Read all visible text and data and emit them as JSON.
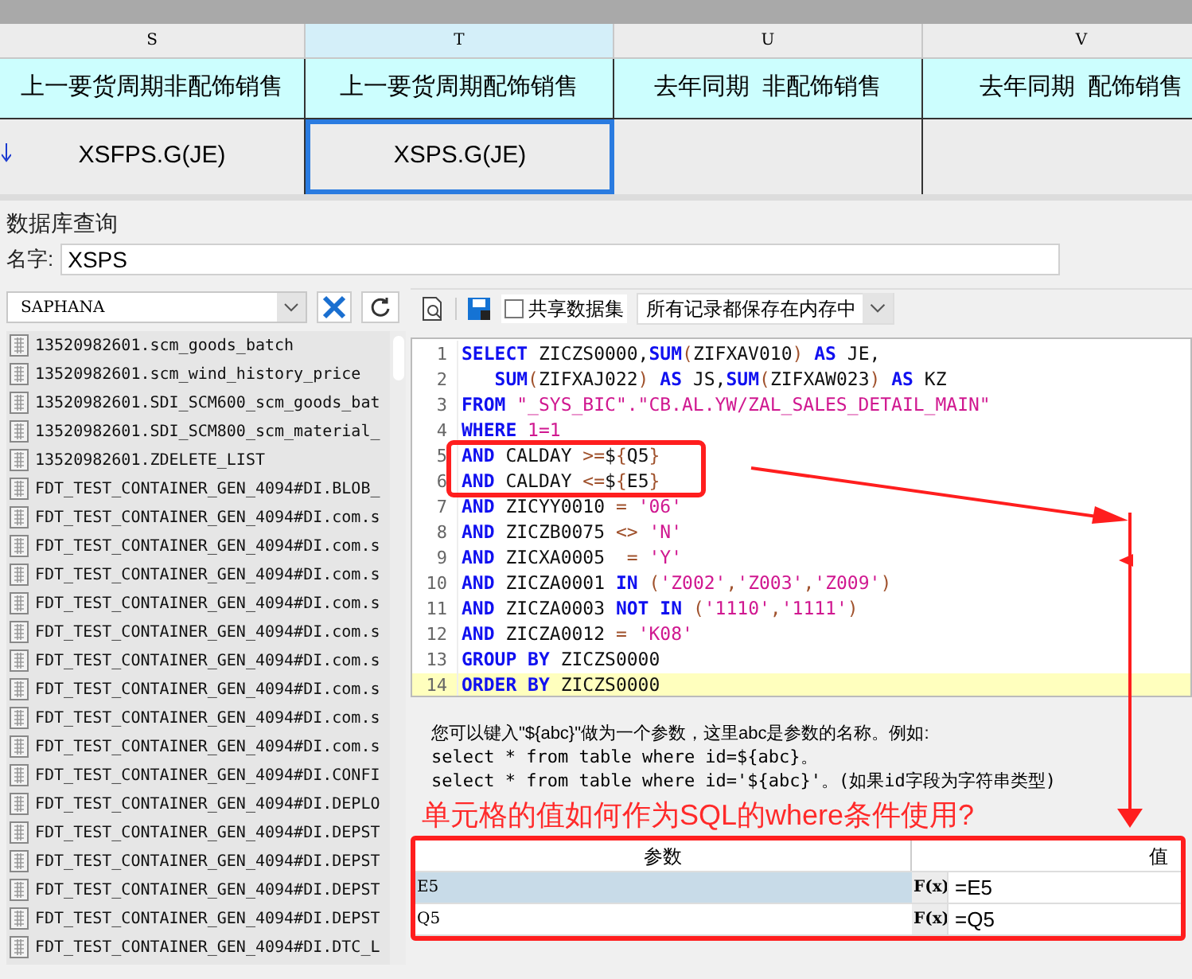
{
  "sheet": {
    "columns": [
      {
        "letter": "S",
        "selected": false
      },
      {
        "letter": "T",
        "selected": true
      },
      {
        "letter": "U",
        "selected": false
      },
      {
        "letter": "V",
        "selected": false
      }
    ],
    "header_row": [
      "上一要货周期非配饰销售",
      "上一要货周期配饰销售",
      "去年同期  非配饰销售",
      "去年同期  配饰销售"
    ],
    "value_row": [
      {
        "text": "XSFPS.G(JE)",
        "selected": false
      },
      {
        "text": "XSPS.G(JE)",
        "selected": true
      },
      {
        "selected": false
      },
      {
        "selected": false
      }
    ]
  },
  "dialog": {
    "title": "数据库查询",
    "name_label": "名字:",
    "name_value": "XSPS",
    "datasource": "SAPHANA",
    "tables": [
      "13520982601.scm_goods_batch",
      "13520982601.scm_wind_history_price",
      "13520982601.SDI_SCM600_scm_goods_bat",
      "13520982601.SDI_SCM800_scm_material_",
      "13520982601.ZDELETE_LIST",
      "FDT_TEST_CONTAINER_GEN_4094#DI.BLOB_",
      "FDT_TEST_CONTAINER_GEN_4094#DI.com.s",
      "FDT_TEST_CONTAINER_GEN_4094#DI.com.s",
      "FDT_TEST_CONTAINER_GEN_4094#DI.com.s",
      "FDT_TEST_CONTAINER_GEN_4094#DI.com.s",
      "FDT_TEST_CONTAINER_GEN_4094#DI.com.s",
      "FDT_TEST_CONTAINER_GEN_4094#DI.com.s",
      "FDT_TEST_CONTAINER_GEN_4094#DI.com.s",
      "FDT_TEST_CONTAINER_GEN_4094#DI.com.s",
      "FDT_TEST_CONTAINER_GEN_4094#DI.com.s",
      "FDT_TEST_CONTAINER_GEN_4094#DI.CONFI",
      "FDT_TEST_CONTAINER_GEN_4094#DI.DEPLO",
      "FDT_TEST_CONTAINER_GEN_4094#DI.DEPST",
      "FDT_TEST_CONTAINER_GEN_4094#DI.DEPST",
      "FDT_TEST_CONTAINER_GEN_4094#DI.DEPST",
      "FDT_TEST_CONTAINER_GEN_4094#DI.DEPST",
      "FDT_TEST_CONTAINER_GEN_4094#DI.DTC_L"
    ],
    "share_dataset": {
      "label": "共享数据集",
      "checked": false
    },
    "storage_mode": "所有记录都保存在内存中",
    "sql_lines": [
      {
        "number": "1",
        "current": false,
        "tokens": [
          {
            "kind": "keyword",
            "text": "SELECT"
          },
          {
            "kind": "ident",
            "text": " ZICZS0000,"
          },
          {
            "kind": "keyword",
            "text": "SUM"
          },
          {
            "kind": "op",
            "text": "("
          },
          {
            "kind": "ident",
            "text": "ZIFXAV010"
          },
          {
            "kind": "op",
            "text": ")"
          },
          {
            "kind": "keyword",
            "text": " AS"
          },
          {
            "kind": "ident",
            "text": " JE,"
          }
        ]
      },
      {
        "number": "2",
        "current": false,
        "tokens": [
          {
            "kind": "keyword",
            "text": "   SUM"
          },
          {
            "kind": "op",
            "text": "("
          },
          {
            "kind": "ident",
            "text": "ZIFXAJ022"
          },
          {
            "kind": "op",
            "text": ")"
          },
          {
            "kind": "keyword",
            "text": " AS"
          },
          {
            "kind": "ident",
            "text": " JS,"
          },
          {
            "kind": "keyword",
            "text": "SUM"
          },
          {
            "kind": "op",
            "text": "("
          },
          {
            "kind": "ident",
            "text": "ZIFXAW023"
          },
          {
            "kind": "op",
            "text": ")"
          },
          {
            "kind": "keyword",
            "text": " AS"
          },
          {
            "kind": "ident",
            "text": " KZ"
          }
        ]
      },
      {
        "number": "3",
        "current": false,
        "tokens": [
          {
            "kind": "keyword",
            "text": "FROM"
          },
          {
            "kind": "string",
            "text": " \"_SYS_BIC\".\"CB.AL.YW/ZAL_SALES_DETAIL_MAIN\""
          }
        ]
      },
      {
        "number": "4",
        "current": false,
        "tokens": [
          {
            "kind": "keyword",
            "text": "WHERE"
          },
          {
            "kind": "string",
            "text": " 1=1"
          }
        ]
      },
      {
        "number": "5",
        "current": false,
        "tokens": [
          {
            "kind": "keyword",
            "text": "AND"
          },
          {
            "kind": "ident",
            "text": " CALDAY "
          },
          {
            "kind": "op",
            "text": ">="
          },
          {
            "kind": "ident",
            "text": "$"
          },
          {
            "kind": "op",
            "text": "{"
          },
          {
            "kind": "ident",
            "text": "Q5"
          },
          {
            "kind": "op",
            "text": "}"
          }
        ]
      },
      {
        "number": "6",
        "current": false,
        "tokens": [
          {
            "kind": "keyword",
            "text": "AND"
          },
          {
            "kind": "ident",
            "text": " CALDAY "
          },
          {
            "kind": "op",
            "text": "<="
          },
          {
            "kind": "ident",
            "text": "$"
          },
          {
            "kind": "op",
            "text": "{"
          },
          {
            "kind": "ident",
            "text": "E5"
          },
          {
            "kind": "op",
            "text": "}"
          }
        ]
      },
      {
        "number": "7",
        "current": false,
        "tokens": [
          {
            "kind": "keyword",
            "text": "AND"
          },
          {
            "kind": "ident",
            "text": " ZICYY0010 "
          },
          {
            "kind": "op",
            "text": "="
          },
          {
            "kind": "string",
            "text": " '06'"
          }
        ]
      },
      {
        "number": "8",
        "current": false,
        "tokens": [
          {
            "kind": "keyword",
            "text": "AND"
          },
          {
            "kind": "ident",
            "text": " ZICZB0075 "
          },
          {
            "kind": "op",
            "text": "<>"
          },
          {
            "kind": "string",
            "text": " 'N'"
          }
        ]
      },
      {
        "number": "9",
        "current": false,
        "tokens": [
          {
            "kind": "keyword",
            "text": "AND"
          },
          {
            "kind": "ident",
            "text": " ZICXA0005  "
          },
          {
            "kind": "op",
            "text": "="
          },
          {
            "kind": "string",
            "text": " 'Y'"
          }
        ]
      },
      {
        "number": "10",
        "current": false,
        "tokens": [
          {
            "kind": "keyword",
            "text": "AND"
          },
          {
            "kind": "ident",
            "text": " ZICZA0001 "
          },
          {
            "kind": "keyword",
            "text": "IN"
          },
          {
            "kind": "op",
            "text": " ("
          },
          {
            "kind": "string",
            "text": "'Z002'"
          },
          {
            "kind": "op",
            "text": ","
          },
          {
            "kind": "string",
            "text": "'Z003'"
          },
          {
            "kind": "op",
            "text": ","
          },
          {
            "kind": "string",
            "text": "'Z009'"
          },
          {
            "kind": "op",
            "text": ")"
          }
        ]
      },
      {
        "number": "11",
        "current": false,
        "tokens": [
          {
            "kind": "keyword",
            "text": "AND"
          },
          {
            "kind": "ident",
            "text": " ZICZA0003 "
          },
          {
            "kind": "keyword",
            "text": "NOT"
          },
          {
            "kind": "keyword",
            "text": " IN"
          },
          {
            "kind": "op",
            "text": " ("
          },
          {
            "kind": "string",
            "text": "'1110'"
          },
          {
            "kind": "op",
            "text": ","
          },
          {
            "kind": "string",
            "text": "'1111'"
          },
          {
            "kind": "op",
            "text": ")"
          }
        ]
      },
      {
        "number": "12",
        "current": false,
        "tokens": [
          {
            "kind": "keyword",
            "text": "AND"
          },
          {
            "kind": "ident",
            "text": " ZICZA0012 "
          },
          {
            "kind": "op",
            "text": "="
          },
          {
            "kind": "string",
            "text": " 'K08'"
          }
        ]
      },
      {
        "number": "13",
        "current": false,
        "tokens": [
          {
            "kind": "keyword",
            "text": "GROUP"
          },
          {
            "kind": "keyword",
            "text": " BY"
          },
          {
            "kind": "ident",
            "text": " ZICZS0000"
          }
        ]
      },
      {
        "number": "14",
        "current": true,
        "tokens": [
          {
            "kind": "keyword",
            "text": "ORDER"
          },
          {
            "kind": "keyword",
            "text": " BY"
          },
          {
            "kind": "ident",
            "text": " ZICZS0000"
          }
        ]
      }
    ],
    "help_lines": [
      "您可以键入\"${abc}\"做为一个参数，这里abc是参数的名称。例如:",
      "select * from table where id=${abc}。",
      "select * from table where id='${abc}'。(如果id字段为字符串类型)"
    ],
    "annotation": "单元格的值如何作为SQL的where条件使用?",
    "params": {
      "columns": [
        "参数",
        "值"
      ],
      "rows": [
        {
          "name": "E5",
          "formula": "F(x)",
          "value": "=E5",
          "selected": true
        },
        {
          "name": "Q5",
          "formula": "F(x)",
          "value": "=Q5",
          "selected": false
        }
      ]
    }
  }
}
